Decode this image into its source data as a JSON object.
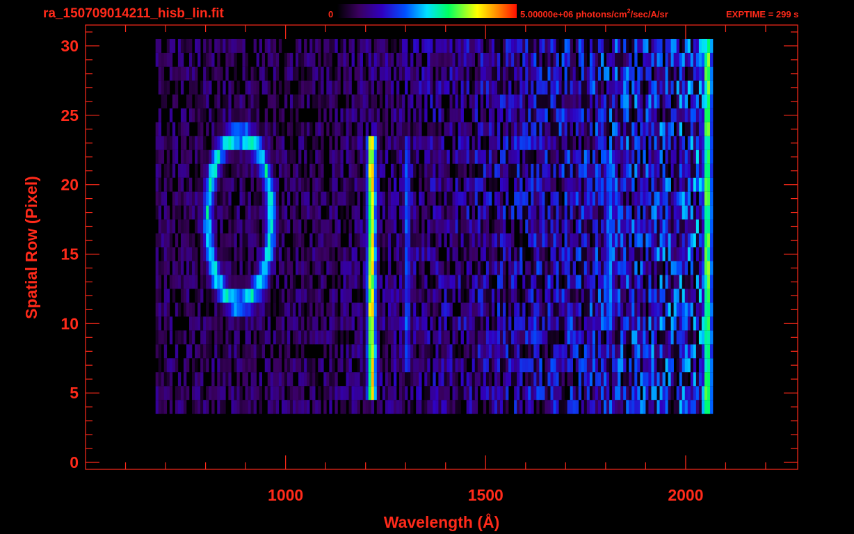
{
  "header": {
    "filename": "ra_150709014211_hisb_lin.fit",
    "colorbar_min": "0",
    "colorbar_max_label": "5.00000e+06 photons/cm",
    "colorbar_exp": "2",
    "colorbar_unit_tail": "/sec/A/sr",
    "exptime": "EXPTIME = 299 s"
  },
  "colors": {
    "axis": "#ff2a1a",
    "background": "#000000",
    "colormap": [
      "#000000",
      "#3a0060",
      "#4b00a0",
      "#2020ff",
      "#0090ff",
      "#00ffff",
      "#00ff60",
      "#ffff00",
      "#ff8000",
      "#ff0000"
    ]
  },
  "chart_data": {
    "type": "heatmap",
    "title": "ra_150709014211_hisb_lin.fit",
    "xlabel": "Wavelength (Å)",
    "ylabel": "Spatial Row (Pixel)",
    "xlim": [
      500,
      2280
    ],
    "ylim": [
      -0.5,
      31.5
    ],
    "xticks": [
      1000,
      1500,
      2000
    ],
    "yticks": [
      0,
      5,
      10,
      15,
      20,
      25,
      30
    ],
    "colorbar": {
      "min": 0,
      "max": 5000000,
      "unit": "photons/cm^2/sec/A/sr"
    },
    "signal_region": {
      "x_range": [
        675,
        2070
      ],
      "row_range": [
        4,
        30
      ]
    },
    "features": [
      {
        "name": "ring",
        "x_center": 885,
        "x_halfwidth": 80,
        "row_center": 17.5,
        "row_halfwidth": 6,
        "intensity": 0.55
      },
      {
        "name": "line",
        "x": 1215,
        "halfwidth": 12,
        "row_range": [
          5,
          23
        ],
        "intensity": 0.82
      },
      {
        "name": "line",
        "x": 1304,
        "halfwidth": 8,
        "row_range": [
          7,
          23
        ],
        "intensity": 0.42
      },
      {
        "name": "band",
        "x": 1810,
        "halfwidth": 14,
        "row_range": [
          10,
          22
        ],
        "intensity": 0.42
      },
      {
        "name": "edge",
        "x": 2055,
        "halfwidth": 12,
        "row_range": [
          3,
          30
        ],
        "intensity": 0.72
      }
    ]
  }
}
